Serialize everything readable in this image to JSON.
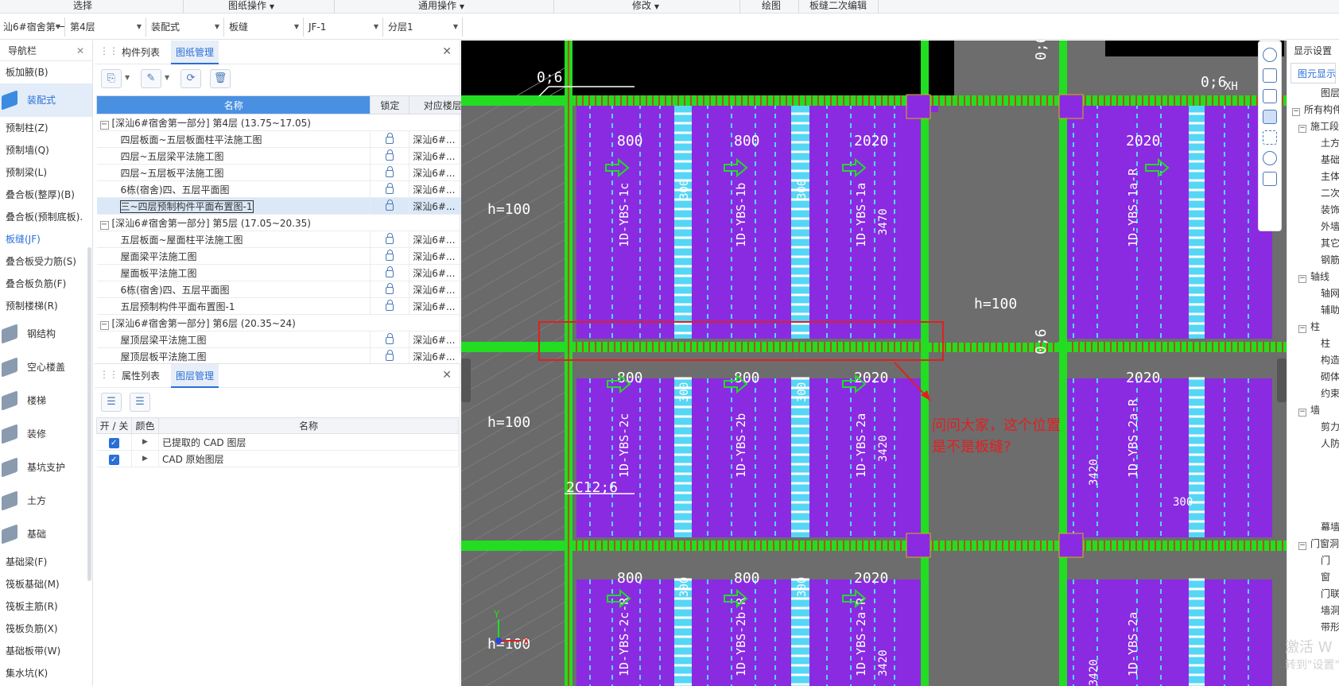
{
  "menubar": {
    "items": [
      "选择",
      "图纸操作",
      "通用操作",
      "修改",
      "绘图",
      "板缝二次编辑"
    ]
  },
  "toolbar": {
    "project": "汕6#宿舍第一",
    "floor": "第4层",
    "category": "装配式",
    "type": "板缝",
    "element": "JF-1",
    "layer": "分层1"
  },
  "nav": {
    "title": "导航栏",
    "items": [
      {
        "label": "板加腋(B)",
        "kind": "text"
      },
      {
        "label": "装配式",
        "kind": "big",
        "selected": true
      },
      {
        "label": "预制柱(Z)",
        "kind": "text"
      },
      {
        "label": "预制墙(Q)",
        "kind": "text"
      },
      {
        "label": "预制梁(L)",
        "kind": "text"
      },
      {
        "label": "叠合板(整厚)(B)",
        "kind": "text"
      },
      {
        "label": "叠合板(预制底板).",
        "kind": "text"
      },
      {
        "label": "板缝(JF)",
        "kind": "text",
        "active": true
      },
      {
        "label": "叠合板受力筋(S)",
        "kind": "text"
      },
      {
        "label": "叠合板负筋(F)",
        "kind": "text"
      },
      {
        "label": "预制楼梯(R)",
        "kind": "text"
      },
      {
        "label": "钢结构",
        "kind": "big"
      },
      {
        "label": "空心楼盖",
        "kind": "big"
      },
      {
        "label": "楼梯",
        "kind": "big"
      },
      {
        "label": "装修",
        "kind": "big"
      },
      {
        "label": "基坑支护",
        "kind": "big"
      },
      {
        "label": "土方",
        "kind": "big"
      },
      {
        "label": "基础",
        "kind": "big"
      },
      {
        "label": "基础梁(F)",
        "kind": "text"
      },
      {
        "label": "筏板基础(M)",
        "kind": "text"
      },
      {
        "label": "筏板主筋(R)",
        "kind": "text"
      },
      {
        "label": "筏板负筋(X)",
        "kind": "text"
      },
      {
        "label": "基础板带(W)",
        "kind": "text"
      },
      {
        "label": "集水坑(K)",
        "kind": "text"
      }
    ]
  },
  "drawingPanel": {
    "tabs": [
      "构件列表",
      "图纸管理"
    ],
    "activeTab": "图纸管理",
    "columns": [
      "名称",
      "锁定",
      "对应楼层"
    ],
    "rows": [
      {
        "name": "[深汕6#宿舍第一部分] 第4层 (13.75~17.05)",
        "group": true
      },
      {
        "name": "四层板面~五层板面柱平法施工图",
        "floor": "深汕6#..."
      },
      {
        "name": "四层~五层梁平法施工图",
        "floor": "深汕6#..."
      },
      {
        "name": "四层~五层板平法施工图",
        "floor": "深汕6#..."
      },
      {
        "name": "6栋(宿舍)四、五层平面图",
        "floor": "深汕6#..."
      },
      {
        "name": "三~四层预制构件平面布置图-1",
        "floor": "深汕6#...",
        "selected": true
      },
      {
        "name": "[深汕6#宿舍第一部分] 第5层 (17.05~20.35)",
        "group": true
      },
      {
        "name": "五层板面~屋面柱平法施工图",
        "floor": "深汕6#..."
      },
      {
        "name": "屋面梁平法施工图",
        "floor": "深汕6#..."
      },
      {
        "name": "屋面板平法施工图",
        "floor": "深汕6#..."
      },
      {
        "name": "6栋(宿舍)四、五层平面图",
        "floor": "深汕6#..."
      },
      {
        "name": "五层预制构件平面布置图-1",
        "floor": "深汕6#..."
      },
      {
        "name": "[深汕6#宿舍第一部分] 第6层 (20.35~24)",
        "group": true
      },
      {
        "name": "屋顶层梁平法施工图",
        "floor": "深汕6#..."
      },
      {
        "name": "屋顶层板平法施工图",
        "floor": "深汕6#..."
      }
    ]
  },
  "layerPanel": {
    "tabs": [
      "属性列表",
      "图层管理"
    ],
    "activeTab": "图层管理",
    "columns": [
      "开 / 关",
      "颜色",
      "名称"
    ],
    "rows": [
      {
        "name": "已提取的 CAD 图层",
        "on": true
      },
      {
        "name": "CAD 原始图层",
        "on": true
      }
    ]
  },
  "canvas": {
    "labels": {
      "dim_top_left": "0;6",
      "dim_top_right1": "0;6",
      "dim_top_right2": "0;6",
      "dim_mid": "0;6",
      "h1": "h=100",
      "h2": "h=100",
      "h3": "h=100",
      "h4": "h=100",
      "rebar": "2C12;6",
      "xh": "XH",
      "annotation_line1": "问问大家，这个位置",
      "annotation_line2": "是不是板缝?",
      "axis_x": "X",
      "axis_y": "Y"
    },
    "slabsRow1": [
      {
        "code": "1D-YBS-1c",
        "width": "800",
        "seam": "300"
      },
      {
        "code": "1D-YBS-1b",
        "width": "800",
        "seam": "300"
      },
      {
        "code": "1D-YBS-1a",
        "width": "2020",
        "len": "3470"
      },
      {
        "code": "1D-YBS-1a-R",
        "width": "2020"
      }
    ],
    "slabsRow2": [
      {
        "code": "1D-YBS-2c",
        "width": "800",
        "seam": "300"
      },
      {
        "code": "1D-YBS-2b",
        "width": "800",
        "seam": "300"
      },
      {
        "code": "1D-YBS-2a",
        "width": "2020",
        "len": "3420"
      },
      {
        "code": "1D-YBS-2a-R",
        "width": "2020",
        "len": "3420",
        "seam": "300"
      }
    ],
    "slabsRow3": [
      {
        "code": "1D-YBS-2c-R",
        "width": "800",
        "seam": "300"
      },
      {
        "code": "1D-YBS-2b-R",
        "width": "800",
        "seam": "300"
      },
      {
        "code": "1D-YBS-2a-R",
        "width": "2020",
        "len": "3420"
      },
      {
        "code": "1D-YBS-2a",
        "len": "3420"
      }
    ],
    "colors": {
      "slab": "#8a2be2",
      "beam": "#22dd22",
      "seam": "#55d6f5",
      "rebar": "#e02020",
      "highlight": "#e02020",
      "background": "#6d6d6d"
    }
  },
  "rightPanel": {
    "title": "显示设置",
    "tab": "图元显示",
    "colHeader": "图层",
    "items": [
      {
        "label": "所有构件",
        "expander": true
      },
      {
        "label": "施工段",
        "expander": true
      },
      {
        "label": "土方"
      },
      {
        "label": "基础"
      },
      {
        "label": "主体"
      },
      {
        "label": "二次"
      },
      {
        "label": "装饰"
      },
      {
        "label": "外墙"
      },
      {
        "label": "其它"
      },
      {
        "label": "钢筋"
      },
      {
        "label": "轴线",
        "expander": true
      },
      {
        "label": "轴网"
      },
      {
        "label": "辅助"
      },
      {
        "label": "柱",
        "expander": true
      },
      {
        "label": "柱"
      },
      {
        "label": "构造"
      },
      {
        "label": "砌体"
      },
      {
        "label": "约束"
      },
      {
        "label": "墙",
        "expander": true
      },
      {
        "label": "剪力"
      },
      {
        "label": "人防"
      },
      {
        "label": ""
      },
      {
        "label": ""
      },
      {
        "label": ""
      },
      {
        "label": ""
      },
      {
        "label": "幕墙"
      },
      {
        "label": "门窗洞",
        "expander": true
      },
      {
        "label": "门"
      },
      {
        "label": "窗"
      },
      {
        "label": "门联"
      },
      {
        "label": "墙洞"
      },
      {
        "label": "带形"
      }
    ]
  },
  "watermark": {
    "line1": "激活 W",
    "line2": "转到\"设置\""
  }
}
